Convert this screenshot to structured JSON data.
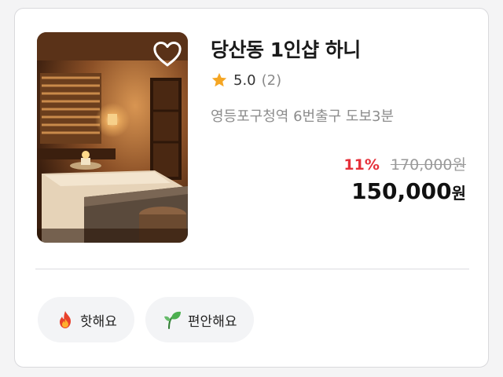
{
  "shop": {
    "name": "당산동 1인샵 하니",
    "rating": "5.0",
    "review_count": "(2)",
    "location": "영등포구청역 6번출구 도보3분"
  },
  "price": {
    "discount": "11%",
    "original": "170,000원",
    "final_number": "150,000",
    "final_unit": "원"
  },
  "tags": [
    {
      "label": "핫해요",
      "icon": "fire-icon"
    },
    {
      "label": "편안해요",
      "icon": "leaf-icon"
    }
  ],
  "icons": {
    "favorite": "heart-icon",
    "rating": "star-icon"
  },
  "colors": {
    "discount": "#e5303a",
    "star": "#f5a623",
    "tag_bg": "#f3f4f6"
  }
}
